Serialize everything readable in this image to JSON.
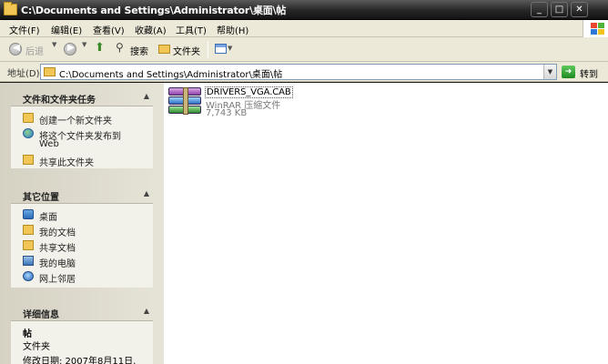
{
  "window": {
    "title": "C:\\Documents and Settings\\Administrator\\桌面\\帖",
    "minimize": "_",
    "maximize": "□",
    "close": "✕"
  },
  "menubar": [
    "文件(F)",
    "编辑(E)",
    "查看(V)",
    "收藏(A)",
    "工具(T)",
    "帮助(H)"
  ],
  "toolbar": {
    "back_label": "后退",
    "search_label": "搜索",
    "folders_label": "文件夹"
  },
  "address": {
    "label": "地址(D)",
    "value": "C:\\Documents and Settings\\Administrator\\桌面\\帖",
    "go_label": "转到"
  },
  "taskpane": {
    "file_tasks": {
      "title": "文件和文件夹任务",
      "items": [
        {
          "label": "创建一个新文件夹",
          "icon": "new-folder-icon"
        },
        {
          "label": "将这个文件夹发布到",
          "label2": "Web",
          "icon": "publish-web-icon"
        },
        {
          "label": "共享此文件夹",
          "icon": "share-folder-icon"
        }
      ]
    },
    "other_places": {
      "title": "其它位置",
      "items": [
        {
          "label": "桌面",
          "icon": "desktop-icon"
        },
        {
          "label": "我的文档",
          "icon": "my-documents-icon"
        },
        {
          "label": "共享文档",
          "icon": "shared-documents-icon"
        },
        {
          "label": "我的电脑",
          "icon": "my-computer-icon"
        },
        {
          "label": "网上邻居",
          "icon": "network-places-icon"
        }
      ]
    },
    "details": {
      "title": "详细信息",
      "name": "帖",
      "type": "文件夹",
      "modified": "修改日期: 2007年8月11日,"
    }
  },
  "files": [
    {
      "name": "DRIVERS_VGA.CAB",
      "type": "WinRAR 压缩文件",
      "size": "7,743 KB",
      "icon": "winrar-archive-icon"
    }
  ],
  "colors": {
    "titlebar": "#262626",
    "chrome": "#ece9d8",
    "taskpane": "#d5d2c4",
    "go_green": "#1f8a1f"
  }
}
